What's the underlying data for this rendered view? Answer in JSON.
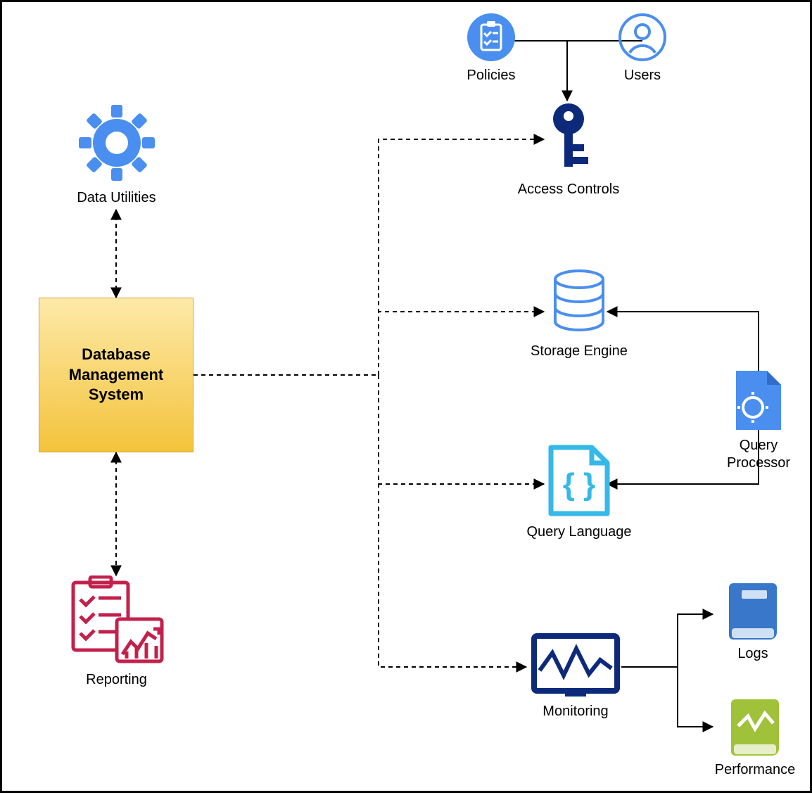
{
  "nodes": {
    "policies": {
      "label": "Policies"
    },
    "users": {
      "label": "Users"
    },
    "dataUtilities": {
      "label": "Data Utilities"
    },
    "accessControls": {
      "label": "Access Controls"
    },
    "dbms": {
      "line1": "Database",
      "line2": "Management",
      "line3": "System"
    },
    "storageEngine": {
      "label": "Storage Engine"
    },
    "queryProcessor": {
      "line1": "Query",
      "line2": "Processor"
    },
    "queryLanguage": {
      "label": "Query Language"
    },
    "reporting": {
      "label": "Reporting"
    },
    "monitoring": {
      "label": "Monitoring"
    },
    "logs": {
      "label": "Logs"
    },
    "performance": {
      "label": "Performance"
    }
  },
  "colors": {
    "blueIcon": "#4a8ef0",
    "darkNavy": "#0d2a7a",
    "skyBlue": "#35b9e6",
    "magenta": "#c4204c",
    "bookBlue": "#3877c9",
    "green": "#a0c23a",
    "boxYellowTop": "#fde9a8",
    "boxYellowBottom": "#f3c33b",
    "black": "#000000"
  }
}
